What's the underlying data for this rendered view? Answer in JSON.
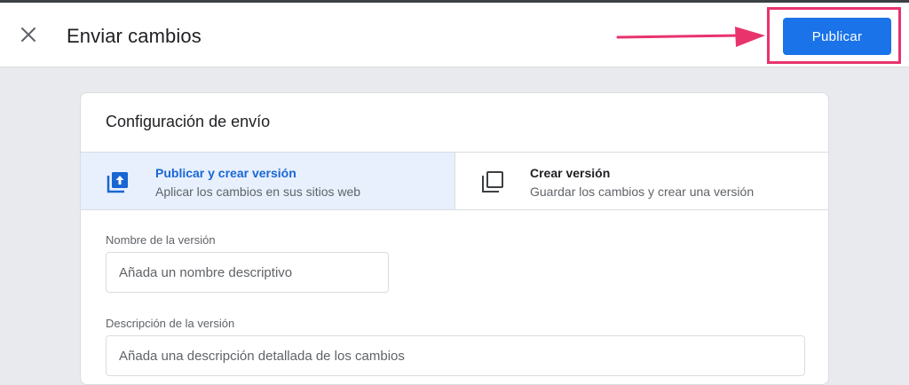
{
  "header": {
    "title": "Enviar cambios",
    "publish_label": "Publicar"
  },
  "card": {
    "title": "Configuración de envío",
    "options": [
      {
        "title": "Publicar y crear versión",
        "subtitle": "Aplicar los cambios en sus sitios web",
        "icon": "publish-icon",
        "selected": true
      },
      {
        "title": "Crear versión",
        "subtitle": "Guardar los cambios y crear una versión",
        "icon": "version-icon",
        "selected": false
      }
    ]
  },
  "form": {
    "version_name": {
      "label": "Nombre de la versión",
      "placeholder": "Añada un nombre descriptivo"
    },
    "version_description": {
      "label": "Descripción de la versión",
      "placeholder": "Añada una descripción detallada de los cambios"
    }
  },
  "colors": {
    "accent": "#1a73e8",
    "selected_bg": "#e8f0fe",
    "highlight": "#e8336d",
    "page_bg": "#e8eaed"
  }
}
